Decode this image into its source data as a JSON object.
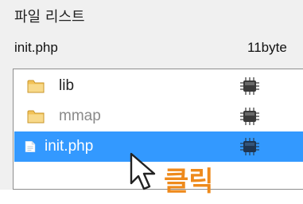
{
  "panel": {
    "title": "파일 리스트",
    "file_name": "init.php",
    "file_size": "11byte"
  },
  "list": {
    "items": [
      {
        "label": "lib",
        "icon": "folder-icon",
        "state": "normal"
      },
      {
        "label": "mmap",
        "icon": "folder-icon",
        "state": "dim"
      },
      {
        "label": "init.php",
        "icon": "file-icon",
        "state": "selected"
      }
    ],
    "status_icon": "chip-icon"
  },
  "annotation": {
    "label": "클릭",
    "color": "#ee8a1c",
    "cursor_icon": "mouse-pointer-icon"
  },
  "colors": {
    "selection": "#3399ff",
    "panel_bg": "#f0f0f0",
    "folder": "#f2c257"
  }
}
